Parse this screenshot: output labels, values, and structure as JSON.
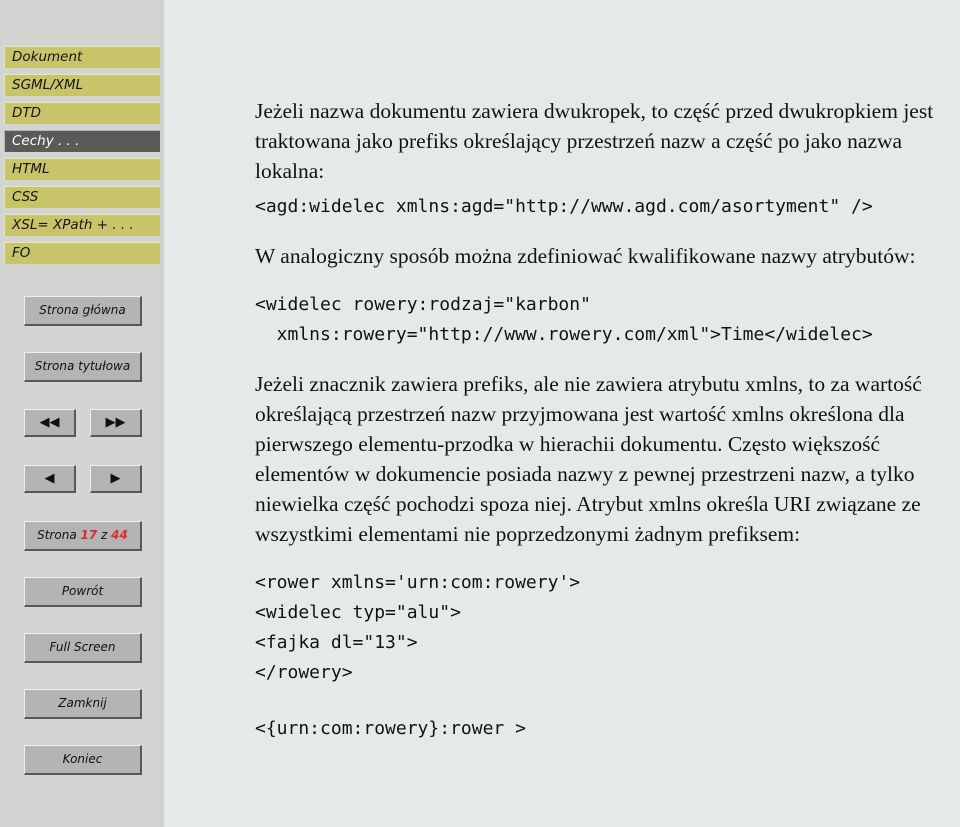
{
  "sidebar": {
    "nav_items": [
      {
        "label": "Dokument",
        "current": false
      },
      {
        "label": "SGML/XML",
        "current": false
      },
      {
        "label": "DTD",
        "current": false
      },
      {
        "label": "Cechy . . .",
        "current": true
      },
      {
        "label": "HTML",
        "current": false
      },
      {
        "label": "CSS",
        "current": false
      },
      {
        "label": "XSL= XPath + . . .",
        "current": false
      },
      {
        "label": "FO",
        "current": false
      }
    ],
    "buttons": {
      "home": "Strona główna",
      "title_page": "Strona tytułowa",
      "first": "◀◀",
      "last": "▶▶",
      "prev": "◀",
      "next": "▶",
      "back": "Powrót",
      "full_screen": "Full Screen",
      "close": "Zamknij",
      "end": "Koniec"
    },
    "page_counter": {
      "prefix": "Strona",
      "current": "17",
      "separator": "z",
      "total": "44"
    },
    "colors": {
      "nav_item_bg": "#c8c46a",
      "nav_item_current_bg": "#5a5a58",
      "sidebar_bg": "#d4d4d2",
      "button_bg": "#b4b4b4",
      "page_number_red": "#e02b2b"
    }
  },
  "content": {
    "background_color": "#e5eae8",
    "para1": "Jeżeli nazwa dokumentu zawiera dwukropek, to część przed dwukropkiem jest traktowana jako prefiks określający przestrzeń nazw a część po jako nazwa lokalna:",
    "code1": "<agd:widelec xmlns:agd=\"http://www.agd.com/asortyment\" />",
    "para2": "W analogiczny sposób można zdefiniować kwalifikowane nazwy atrybutów:",
    "code2": "<widelec rowery:rodzaj=\"karbon\"\n  xmlns:rowery=\"http://www.rowery.com/xml\">Time</widelec>",
    "para3": "Jeżeli znacznik zawiera prefiks, ale nie zawiera atrybutu xmlns, to za wartość określającą przestrzeń nazw przyjmowana jest wartość xmlns określona dla pierwszego elementu-przodka w hierachii dokumentu. Często większość elementów w dokumencie posiada nazwy z pewnej przestrzeni nazw, a tylko niewielka część pochodzi spoza niej. Atrybut xmlns określa URI związane ze wszystkimi elementami nie poprzedzonymi żadnym prefiksem:",
    "code3": "<rower xmlns='urn:com:rowery'>\n<widelec typ=\"alu\">\n<fajka dl=\"13\">\n</rowery>",
    "code4": "<{urn:com:rowery}:rower >"
  }
}
